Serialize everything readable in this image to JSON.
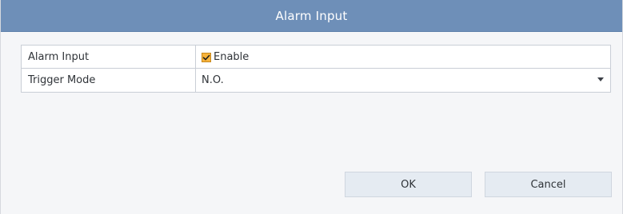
{
  "dialog": {
    "title": "Alarm Input",
    "rows": [
      {
        "label": "Alarm Input",
        "control": "checkbox",
        "checked": true,
        "value_label": "Enable"
      },
      {
        "label": "Trigger Mode",
        "control": "select",
        "value": "N.O."
      }
    ],
    "buttons": {
      "ok_label": "OK",
      "cancel_label": "Cancel"
    },
    "colors": {
      "titlebar": "#6e8fb8",
      "checkbox_fill": "#f7b33b",
      "button_fill": "#e5ebf2",
      "border": "#c9ced6"
    }
  }
}
